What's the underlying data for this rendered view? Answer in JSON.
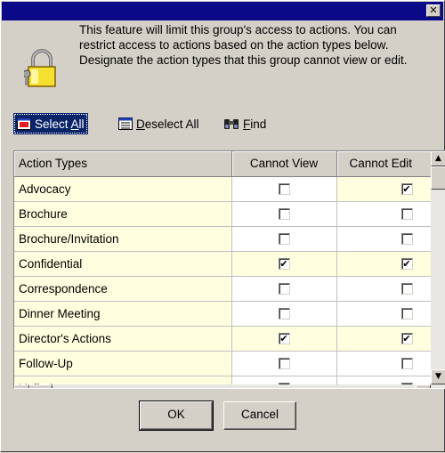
{
  "dialog": {
    "close_glyph": "✕"
  },
  "info": {
    "text": "This feature will limit this group's access to actions.  You can restrict access to actions based on the action types below. Designate the action types that this group cannot view or edit.",
    "icon": "lock-icon"
  },
  "toolbar": {
    "select_all_prefix": "Select ",
    "select_all_accel": "A",
    "select_all_suffix": "ll",
    "deselect_all_accel": "D",
    "deselect_all_suffix": "eselect All",
    "find_accel": "F",
    "find_suffix": "ind"
  },
  "grid": {
    "columns": [
      "Action Types",
      "Cannot View",
      "Cannot Edit"
    ],
    "rows": [
      {
        "type": "Advocacy",
        "cannot_view": false,
        "cannot_edit": true
      },
      {
        "type": "Brochure",
        "cannot_view": false,
        "cannot_edit": false
      },
      {
        "type": "Brochure/Invitation",
        "cannot_view": false,
        "cannot_edit": false
      },
      {
        "type": "Confidential",
        "cannot_view": true,
        "cannot_edit": true
      },
      {
        "type": "Correspondence",
        "cannot_view": false,
        "cannot_edit": false
      },
      {
        "type": "Dinner Meeting",
        "cannot_view": false,
        "cannot_edit": false
      },
      {
        "type": "Director's Actions",
        "cannot_view": true,
        "cannot_edit": true
      },
      {
        "type": "Follow-Up",
        "cannot_view": false,
        "cannot_edit": false
      },
      {
        "type": "Hello Letter",
        "cannot_view": false,
        "cannot_edit": false
      }
    ],
    "checked_glyph": "✔",
    "scroll_up": "▲",
    "scroll_down": "▼",
    "scroll_left": "◀",
    "scroll_right": "▶"
  },
  "buttons": {
    "ok": "OK",
    "cancel": "Cancel"
  },
  "colors": {
    "titlebar": "#0a0a88",
    "highlight": "#0a246a",
    "cell_shade": "#ffffe0"
  }
}
